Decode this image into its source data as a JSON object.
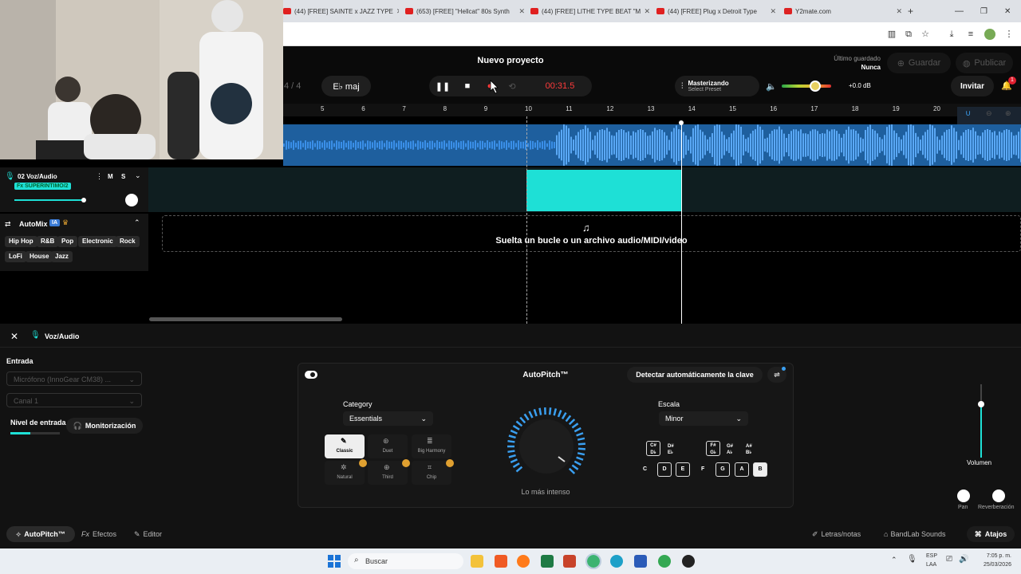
{
  "browser": {
    "tabs": [
      {
        "label": "(44) [FREE] SAINTE x JAZZ TYPE"
      },
      {
        "label": "(653) [FREE] \"Hellcat\" 80s Synth"
      },
      {
        "label": "(44) [FREE] LITHE TYPE BEAT \"M"
      },
      {
        "label": "(44) [FREE] Plug x Detroit Type"
      },
      {
        "label": "Y2mate.com"
      }
    ],
    "new_tab": "+"
  },
  "app": {
    "project_title": "Nuevo proyecto",
    "last_saved_label": "Último guardado",
    "last_saved_value": "Nunca",
    "save_label": "Guardar",
    "publish_label": "Publicar",
    "time_sig": "4 / 4",
    "key": "E♭ maj",
    "timer": "00:31.5",
    "mastering_title": "Masterizando",
    "mastering_preset": "Select Preset",
    "volume_db": "+0.0 dB",
    "invite_label": "Invitar",
    "notification_count": "1"
  },
  "ruler": [
    "5",
    "6",
    "7",
    "8",
    "9",
    "10",
    "11",
    "12",
    "13",
    "14",
    "15",
    "16",
    "17",
    "18",
    "19",
    "20"
  ],
  "track": {
    "name": "02 Voz/Audio",
    "fx": "Fx SUPERINTIMO/2",
    "mute": "M",
    "solo": "S"
  },
  "automix": {
    "title": "AutoMix",
    "ia_badge": "IA",
    "genres": [
      "Hip Hop",
      "R&B",
      "Pop",
      "Electronic",
      "Rock",
      "LoFi",
      "House",
      "Jazz"
    ]
  },
  "dropzone_text": "Suelta un bucle o un archivo audio/MIDI/video",
  "bottom": {
    "panel_title": "Voz/Audio",
    "input_label": "Entrada",
    "mic_select": "Micrófono (InnoGear CM38) ...",
    "channel_select": "Canal 1",
    "input_level_label": "Nivel de entrada",
    "monitor_label": "Monitorización",
    "volume_label": "Volumen",
    "pan_label": "Pan",
    "reverb_label": "Reverberación"
  },
  "autopitch": {
    "title": "AutoPitch™",
    "detect_label": "Detectar automáticamente la clave",
    "category_label": "Category",
    "category_value": "Essentials",
    "scale_label": "Escala",
    "scale_value": "Minor",
    "intensity_label": "Lo más intenso",
    "modes": [
      "Classic",
      "Duet",
      "Big Harmony",
      "Natural",
      "Third",
      "Chip"
    ],
    "keys_top": [
      "C#\nD♭",
      "D#\nE♭",
      "F#\nG♭",
      "G#\nA♭",
      "A#\nB♭"
    ],
    "keys_bottom": [
      "C",
      "D",
      "E",
      "F",
      "G",
      "A",
      "B"
    ]
  },
  "footer_tabs": {
    "autopitch": "AutoPitch™",
    "effects": "Efectos",
    "editor": "Editor",
    "lyrics": "Letras/notas",
    "sounds": "BandLab Sounds",
    "shortcuts": "Atajos"
  },
  "taskbar": {
    "search": "Buscar",
    "lang_top": "ESP",
    "lang_bottom": "LAA",
    "time": "7:05 p. m.",
    "date": "25/03/2026"
  },
  "colors": {
    "accent_teal": "#1ee0d6",
    "wave_blue": "#3a8fe8",
    "timer_red": "#ff3b3b",
    "autopitch_ring": "#3a9ff0"
  }
}
